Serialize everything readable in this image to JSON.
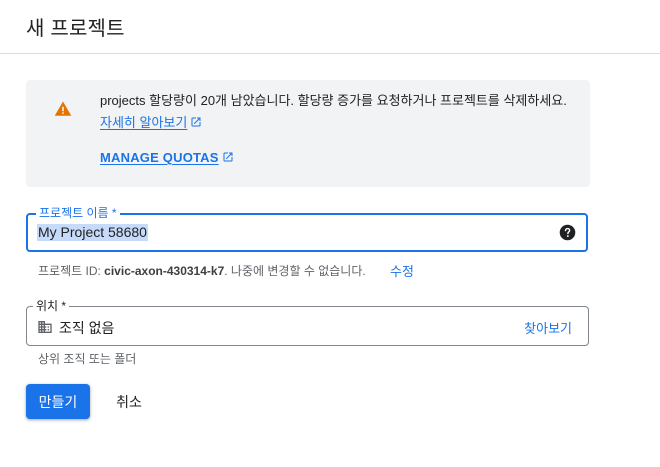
{
  "page": {
    "title": "새 프로젝트",
    "accent_color": "#1a73e8",
    "warning_color": "#e37400"
  },
  "notice": {
    "icon": "warning-icon",
    "message": "projects 할당량이 20개 남았습니다. 할당량 증가를 요청하거나 프로젝트를 삭제하세요.",
    "learn_more_label": "자세히 알아보기",
    "manage_quotas_label": "MANAGE QUOTAS"
  },
  "project_name": {
    "label": "프로젝트 이름 *",
    "value": "My Project 58680",
    "help_icon": "help-icon",
    "hint_prefix": "프로젝트 ID: ",
    "project_id": "civic-axon-430314-k7",
    "hint_suffix": ". 나중에 변경할 수 없습니다.",
    "edit_label": "수정"
  },
  "location": {
    "label": "위치 *",
    "icon": "building-icon",
    "value": "조직 없음",
    "browse_label": "찾아보기",
    "hint": "상위 조직 또는 폴더"
  },
  "actions": {
    "create_label": "만들기",
    "cancel_label": "취소"
  }
}
